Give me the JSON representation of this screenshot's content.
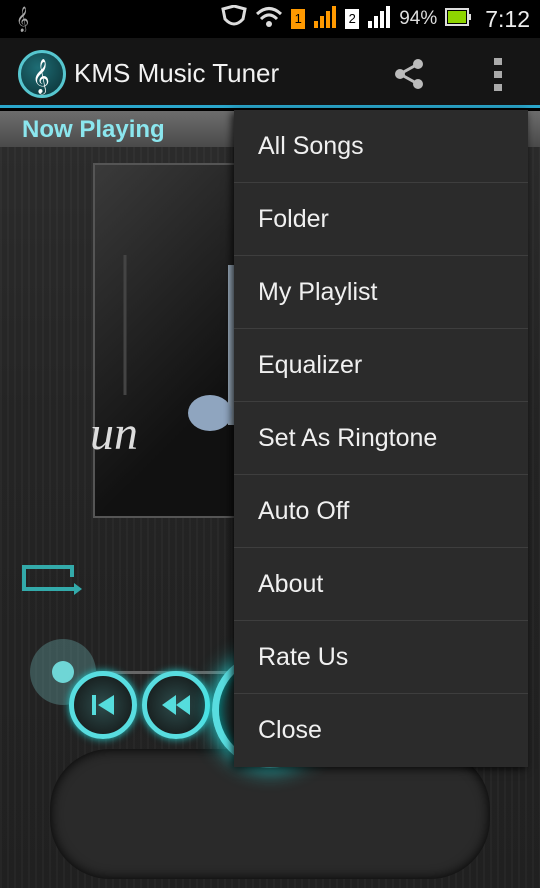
{
  "status_bar": {
    "battery_percent": "94%",
    "time": "7:12",
    "sim_badge_1": "1",
    "sim_badge_2": "2"
  },
  "app": {
    "title": "KMS Music Tuner",
    "accent_color": "#2aa7cc"
  },
  "now_playing": {
    "label": "Now Playing",
    "album_text": "un"
  },
  "player": {
    "seek_progress": 0.0
  },
  "menu": {
    "items": [
      {
        "label": "All Songs"
      },
      {
        "label": "Folder"
      },
      {
        "label": "My Playlist"
      },
      {
        "label": "Equalizer"
      },
      {
        "label": "Set As Ringtone"
      },
      {
        "label": "Auto Off"
      },
      {
        "label": "About"
      },
      {
        "label": "Rate Us"
      },
      {
        "label": "Close"
      }
    ]
  },
  "icons": {
    "status": [
      "music-note-icon",
      "shield-icon",
      "wifi-icon",
      "signal-icon",
      "battery-icon"
    ],
    "actionbar": [
      "treble-clef-logo-icon",
      "share-icon",
      "overflow-menu-icon"
    ],
    "controls": [
      "repeat-icon",
      "previous-icon",
      "rewind-icon",
      "play-icon",
      "fast-forward-icon",
      "next-icon"
    ]
  }
}
